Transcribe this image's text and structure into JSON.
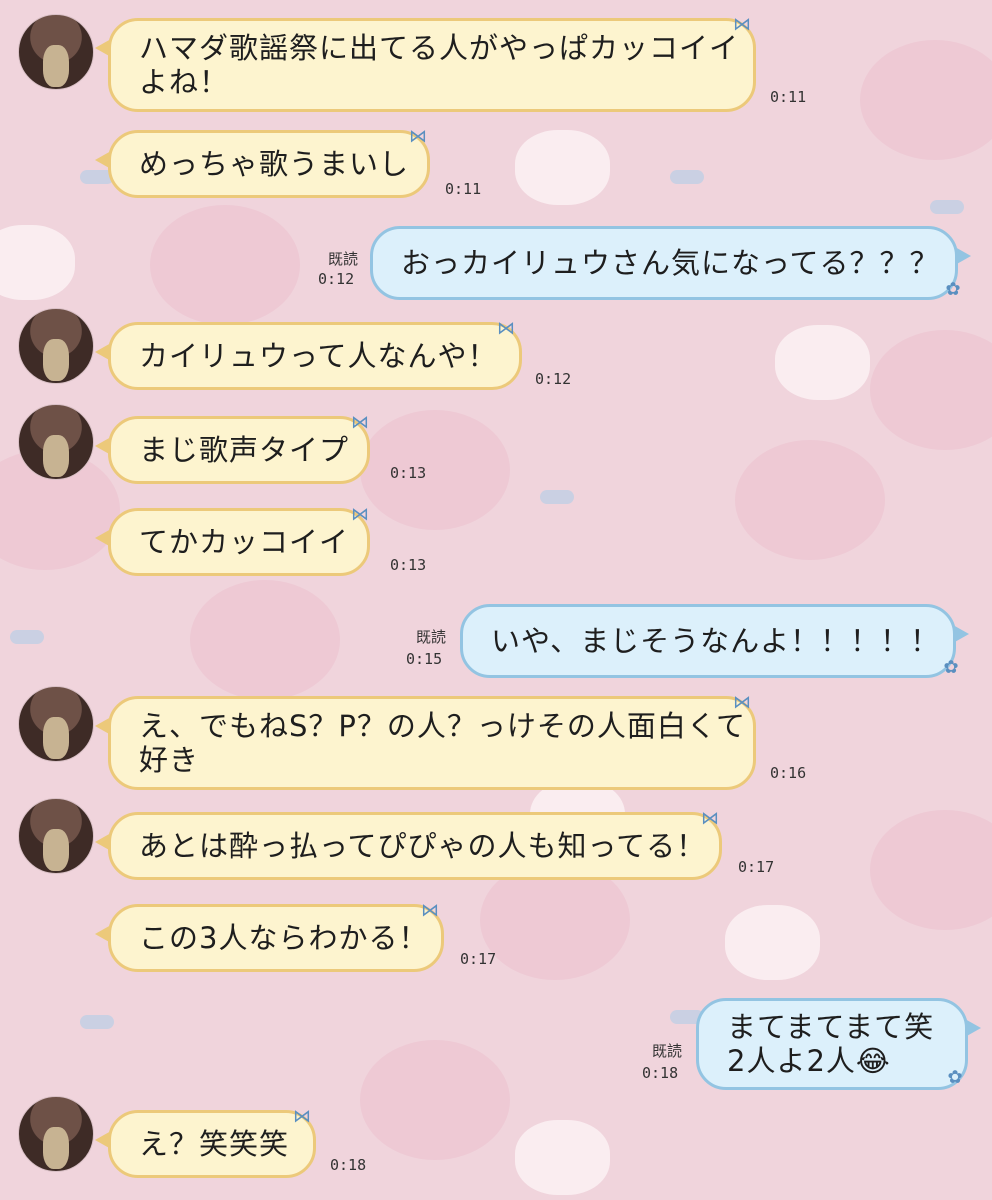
{
  "messages": [
    {
      "side": "in",
      "text": "ハマダ歌謡祭に出てる人がやっぱカッコイイ\nよね！",
      "time": "0:11"
    },
    {
      "side": "in",
      "text": "めっちゃ歌うまいし",
      "time": "0:11"
    },
    {
      "side": "out",
      "text": "おっカイリュウさん気になってる？？？",
      "time": "0:12",
      "read": "既読"
    },
    {
      "side": "in",
      "text": "カイリュウって人なんや！",
      "time": "0:12"
    },
    {
      "side": "in",
      "text": "まじ歌声タイプ",
      "time": "0:13"
    },
    {
      "side": "in",
      "text": "てかカッコイイ",
      "time": "0:13"
    },
    {
      "side": "out",
      "text": "いや、まじそうなんよ！！！！！",
      "time": "0:15",
      "read": "既読"
    },
    {
      "side": "in",
      "text": "え、でもねS？P？の人？っけその人面白くて\n好き",
      "time": "0:16"
    },
    {
      "side": "in",
      "text": "あとは酔っ払ってぴぴゃの人も知ってる！",
      "time": "0:17"
    },
    {
      "side": "in",
      "text": "この3人ならわかる！",
      "time": "0:17"
    },
    {
      "side": "out",
      "text": "まてまてまて笑\n2人よ2人😂",
      "time": "0:18",
      "read": "既読"
    },
    {
      "side": "in",
      "text": "え？笑笑笑",
      "time": "0:18"
    }
  ],
  "icons": {
    "bubble_in_decoration": "bow-icon",
    "bubble_out_decoration": "flower-icon",
    "avatar": "avatar"
  },
  "colors": {
    "background": "#f0d4dc",
    "incoming_bubble": "#fdf4cf",
    "incoming_border": "#ecc97a",
    "outgoing_bubble": "#dcf0fb",
    "outgoing_border": "#93c4e2"
  }
}
